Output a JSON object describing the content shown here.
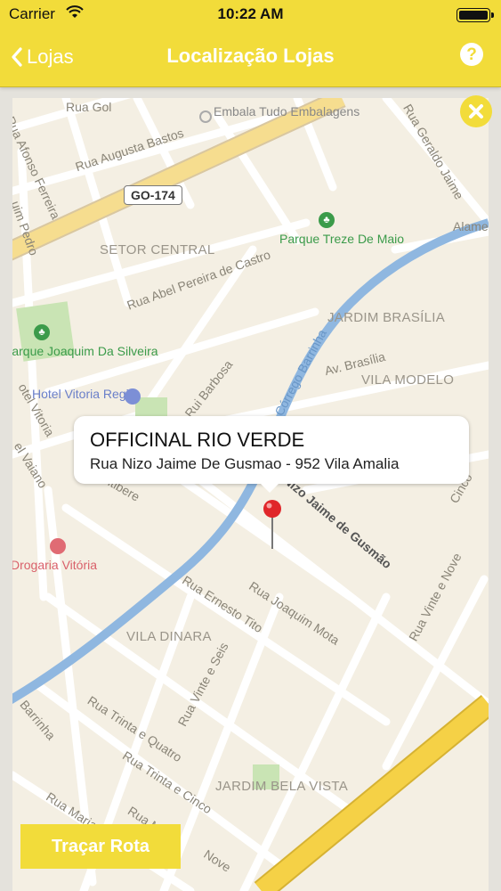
{
  "status_bar": {
    "carrier": "Carrier",
    "time": "10:22 AM"
  },
  "nav": {
    "back_label": "Lojas",
    "title": "Localização Lojas",
    "help_icon": "?"
  },
  "map": {
    "highway_shield": "GO-174",
    "streets": [
      "Rua Gol",
      "Rua Afonso Ferreira",
      "Rua Augusta Bastos",
      "Rua Geraldo Jaime",
      "uim Pedro",
      "Rua Abel Pereira de Castro",
      "Alameda",
      "Rua Rui Barbosa",
      "Av. Brasília",
      "Rua Nizo Jaime de Gusmão",
      "Rua Ernesto Tito",
      "Rua Joaquim Mota",
      "Rua Vinte e Seis",
      "Rua Vinte e Nove",
      "Rua Trinta e Quatro",
      "Rua Trinta e Cinco",
      "Rua Maria Cris",
      "Rua Major",
      "Nove",
      "Barrinha",
      "Cinco",
      "ritibere",
      "otel Vitoria",
      "el Vaiano"
    ],
    "water_label": "Córrego Barrinha",
    "areas": [
      "SETOR CENTRAL",
      "JARDIM BRASÍLIA",
      "VILA MODELO",
      "VILA DINARA",
      "JARDIM BELA VISTA"
    ],
    "parks": [
      "Parque Treze De Maio",
      "Parque Joaquim Da Silveira"
    ],
    "pois": [
      "Embala Tudo Embalagens",
      "Hotel Vitoria Regia",
      "Drogaria Vitória"
    ]
  },
  "store": {
    "name": "OFFICINAL RIO VERDE",
    "address": "Rua Nizo Jaime De Gusmao - 952 Vila Amalia"
  },
  "actions": {
    "route_label": "Traçar Rota"
  },
  "colors": {
    "accent": "#f2dc3a",
    "map_bg": "#f4efe3",
    "pin": "#e0262a",
    "park": "#3b9b4a",
    "highway": "#f5d146"
  }
}
